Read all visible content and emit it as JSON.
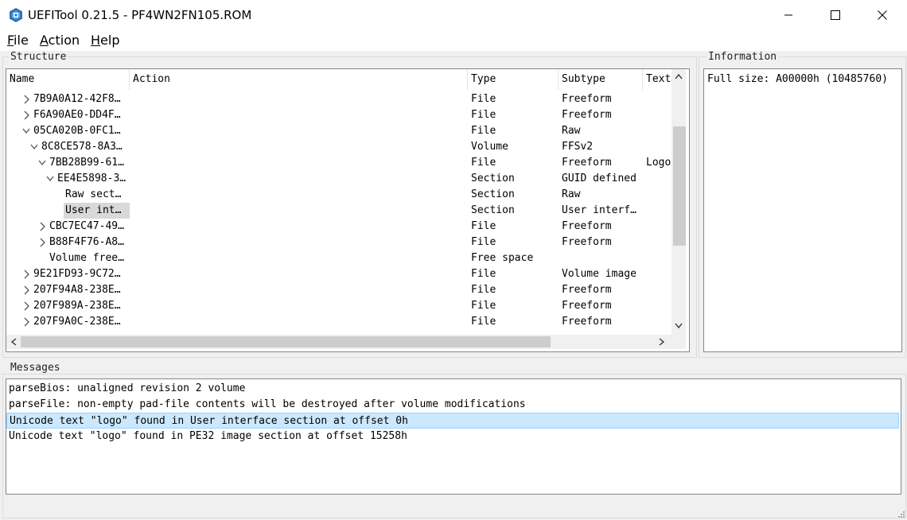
{
  "window": {
    "title": "UEFITool 0.21.5 - PF4WN2FN105.ROM",
    "controls": [
      "minimize",
      "maximize",
      "close"
    ]
  },
  "menu": {
    "items": [
      {
        "accel": "F",
        "rest": "ile"
      },
      {
        "accel": "A",
        "rest": "ction"
      },
      {
        "accel": "H",
        "rest": "elp"
      }
    ]
  },
  "structure": {
    "label": "Structure",
    "columns": [
      "Name",
      "Action",
      "Type",
      "Subtype",
      "Text"
    ],
    "rows": [
      {
        "name": "7B9A0A12-42F8…",
        "type": "File",
        "subtype": "Freeform",
        "text": "",
        "depth": 1,
        "expander": "collapsed"
      },
      {
        "name": "F6A90AE0-DD4F…",
        "type": "File",
        "subtype": "Freeform",
        "text": "",
        "depth": 1,
        "expander": "collapsed"
      },
      {
        "name": "05CA020B-0FC1…",
        "type": "File",
        "subtype": "Raw",
        "text": "",
        "depth": 1,
        "expander": "expanded"
      },
      {
        "name": "8C8CE578-8A3…",
        "type": "Volume",
        "subtype": "FFSv2",
        "text": "",
        "depth": 2,
        "expander": "expanded"
      },
      {
        "name": "7BB28B99-61…",
        "type": "File",
        "subtype": "Freeform",
        "text": "Logo",
        "depth": 3,
        "expander": "expanded"
      },
      {
        "name": "EE4E5898-3…",
        "type": "Section",
        "subtype": "GUID defined",
        "text": "",
        "depth": 4,
        "expander": "expanded"
      },
      {
        "name": "Raw sect…",
        "type": "Section",
        "subtype": "Raw",
        "text": "",
        "depth": 5,
        "expander": "none"
      },
      {
        "name": "User int…",
        "type": "Section",
        "subtype": "User interf…",
        "text": "",
        "depth": 5,
        "expander": "none",
        "selected": true
      },
      {
        "name": "CBC7EC47-49…",
        "type": "File",
        "subtype": "Freeform",
        "text": "",
        "depth": 3,
        "expander": "collapsed"
      },
      {
        "name": "B88F4F76-A8…",
        "type": "File",
        "subtype": "Freeform",
        "text": "",
        "depth": 3,
        "expander": "collapsed"
      },
      {
        "name": "Volume free…",
        "type": "Free space",
        "subtype": "",
        "text": "",
        "depth": 3,
        "expander": "none"
      },
      {
        "name": "9E21FD93-9C72…",
        "type": "File",
        "subtype": "Volume image",
        "text": "",
        "depth": 1,
        "expander": "collapsed"
      },
      {
        "name": "207F94A8-238E…",
        "type": "File",
        "subtype": "Freeform",
        "text": "",
        "depth": 1,
        "expander": "collapsed"
      },
      {
        "name": "207F989A-238E…",
        "type": "File",
        "subtype": "Freeform",
        "text": "",
        "depth": 1,
        "expander": "collapsed"
      },
      {
        "name": "207F9A0C-238E…",
        "type": "File",
        "subtype": "Freeform",
        "text": "",
        "depth": 1,
        "expander": "collapsed"
      }
    ]
  },
  "information": {
    "label": "Information",
    "text": "Full size: A00000h (10485760)"
  },
  "messages": {
    "label": "Messages",
    "items": [
      {
        "text": "parseBios: unaligned revision 2 volume",
        "highlighted": false
      },
      {
        "text": "parseFile: non-empty pad-file contents will be destroyed after volume modifications",
        "highlighted": false
      },
      {
        "text": "Unicode text \"logo\" found in User interface section at offset 0h",
        "highlighted": true
      },
      {
        "text": "Unicode text \"logo\" found in PE32 image section at offset 15258h",
        "highlighted": false
      }
    ]
  },
  "colors": {
    "selection_bg": "#d9d9d9",
    "message_highlight": "#cce8ff",
    "app_icon": "#2a6ebb"
  }
}
